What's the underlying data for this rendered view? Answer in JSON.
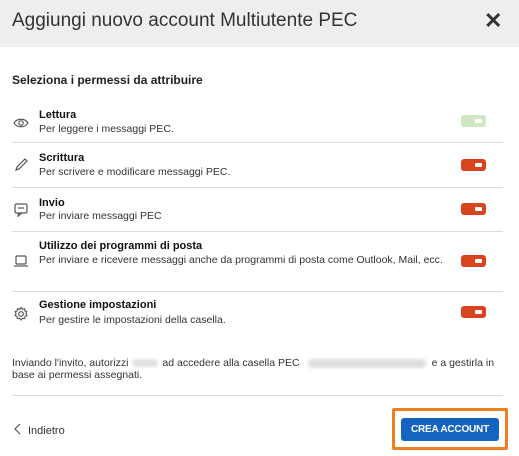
{
  "dialog": {
    "title": "Aggiungi nuovo account Multiutente PEC",
    "close_label": "✕"
  },
  "section_title": "Seleziona i permessi da attribuire",
  "permissions": [
    {
      "name": "Lettura",
      "description": "Per leggere i messaggi PEC.",
      "icon": "eye-icon",
      "enabled_state": "disabled-light-green"
    },
    {
      "name": "Scrittura",
      "description": "Per scrivere e modificare messaggi PEC.",
      "icon": "pencil-icon",
      "enabled_state": "on-red"
    },
    {
      "name": "Invio",
      "description": "Per inviare messaggi PEC",
      "icon": "message-send-icon",
      "enabled_state": "on-red"
    },
    {
      "name": "Utilizzo dei programmi di posta",
      "description": "Per inviare e ricevere messaggi anche da programmi di posta come Outlook, Mail, ecc.",
      "icon": "laptop-icon",
      "enabled_state": "on-red"
    },
    {
      "name": "Gestione impostazioni",
      "description": "Per gestire le impostazioni della casella.",
      "icon": "gear-icon",
      "enabled_state": "on-red"
    }
  ],
  "notice": {
    "part1": "Inviando l'invito, autorizzi",
    "part2": "ad accedere alla casella PEC",
    "part3": "e a gestirla in base ai permessi assegnati."
  },
  "footer": {
    "back_label": "Indietro",
    "create_label": "CREA ACCOUNT"
  },
  "colors": {
    "toggle_on": "#d9441e",
    "toggle_disabled": "#cfe8c2",
    "primary_button": "#1565c0",
    "highlight_border": "#f07f21"
  }
}
